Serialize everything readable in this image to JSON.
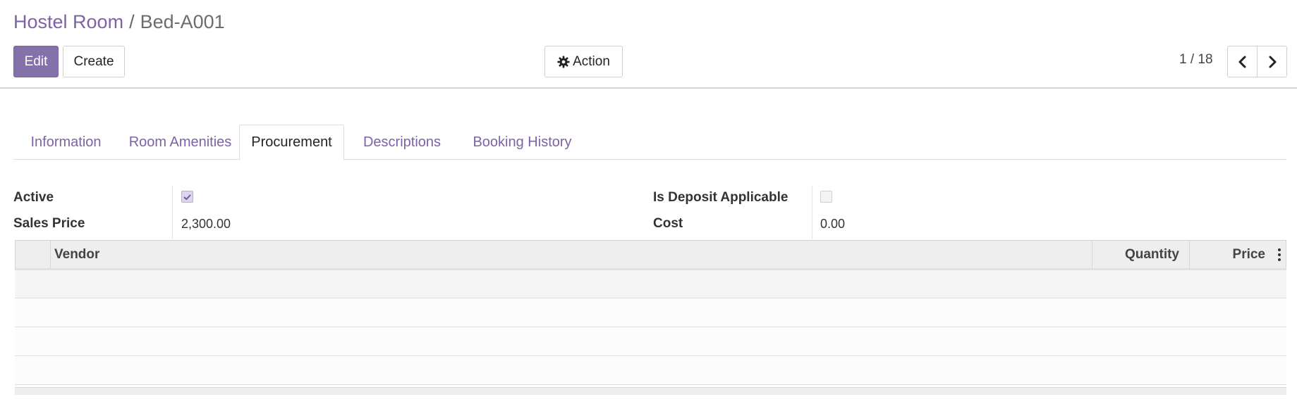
{
  "breadcrumb": {
    "parent": "Hostel Room",
    "separator": "/",
    "current": "Bed-A001"
  },
  "toolbar": {
    "edit_label": "Edit",
    "create_label": "Create",
    "action_label": "Action"
  },
  "pager": {
    "value": "1 / 18"
  },
  "tabs": [
    {
      "label": "Information",
      "active": false
    },
    {
      "label": "Room Amenities",
      "active": false
    },
    {
      "label": "Procurement",
      "active": true
    },
    {
      "label": "Descriptions",
      "active": false
    },
    {
      "label": "Booking History",
      "active": false
    }
  ],
  "fields": {
    "active": {
      "label": "Active",
      "checked": true
    },
    "sales_price": {
      "label": "Sales Price",
      "value": "2,300.00"
    },
    "deposit": {
      "label": "Is Deposit Applicable",
      "checked": false
    },
    "cost": {
      "label": "Cost",
      "value": "0.00"
    }
  },
  "vendor_table": {
    "columns": [
      "Vendor",
      "Quantity",
      "Price"
    ],
    "rows": []
  },
  "icons": [
    "gear-icon",
    "chevron-left-icon",
    "chevron-right-icon",
    "kebab-menu-icon",
    "checkmark-icon"
  ],
  "colors": {
    "accent": "#8571a9",
    "link": "#7c63a8"
  }
}
